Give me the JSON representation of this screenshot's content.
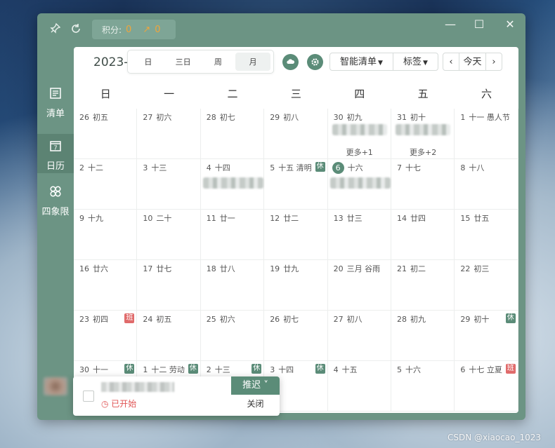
{
  "titlebar": {
    "points_label": "积分:",
    "points_value": "0",
    "trend_value": "0"
  },
  "window_controls": {
    "minimize": "—",
    "maximize": "☐",
    "close": "✕"
  },
  "sidebar": {
    "items": [
      {
        "label": "清单",
        "icon": "list-icon"
      },
      {
        "label": "日历",
        "icon": "calendar-icon",
        "day": "7"
      },
      {
        "label": "四象限",
        "icon": "quadrant-icon"
      }
    ]
  },
  "toolbar": {
    "year": "2023-(",
    "views": [
      "日",
      "三日",
      "周",
      "月"
    ],
    "active_view": "月",
    "smart_list": "智能清单",
    "tags": "标签",
    "prev": "‹",
    "today": "今天",
    "next": "›"
  },
  "weekdays": [
    "日",
    "一",
    "二",
    "三",
    "四",
    "五",
    "六"
  ],
  "weeks": [
    [
      {
        "d": "26",
        "l": "初五"
      },
      {
        "d": "27",
        "l": "初六"
      },
      {
        "d": "28",
        "l": "初七"
      },
      {
        "d": "29",
        "l": "初八"
      },
      {
        "d": "30",
        "l": "初九",
        "more": "更多+1"
      },
      {
        "d": "31",
        "l": "初十",
        "more": "更多+2"
      },
      {
        "d": "1",
        "l": "十一 愚人节"
      }
    ],
    [
      {
        "d": "2",
        "l": "十二"
      },
      {
        "d": "3",
        "l": "十三"
      },
      {
        "d": "4",
        "l": "十四"
      },
      {
        "d": "5",
        "l": "十五 清明",
        "badge": "休"
      },
      {
        "d": "6",
        "l": "十六",
        "today": true
      },
      {
        "d": "7",
        "l": "十七"
      },
      {
        "d": "8",
        "l": "十八"
      }
    ],
    [
      {
        "d": "9",
        "l": "十九"
      },
      {
        "d": "10",
        "l": "二十"
      },
      {
        "d": "11",
        "l": "廿一"
      },
      {
        "d": "12",
        "l": "廿二"
      },
      {
        "d": "13",
        "l": "廿三"
      },
      {
        "d": "14",
        "l": "廿四"
      },
      {
        "d": "15",
        "l": "廿五"
      }
    ],
    [
      {
        "d": "16",
        "l": "廿六"
      },
      {
        "d": "17",
        "l": "廿七"
      },
      {
        "d": "18",
        "l": "廿八"
      },
      {
        "d": "19",
        "l": "廿九"
      },
      {
        "d": "20",
        "l": "三月 谷雨"
      },
      {
        "d": "21",
        "l": "初二"
      },
      {
        "d": "22",
        "l": "初三"
      }
    ],
    [
      {
        "d": "23",
        "l": "初四",
        "badge": "班"
      },
      {
        "d": "24",
        "l": "初五"
      },
      {
        "d": "25",
        "l": "初六"
      },
      {
        "d": "26",
        "l": "初七"
      },
      {
        "d": "27",
        "l": "初八"
      },
      {
        "d": "28",
        "l": "初九"
      },
      {
        "d": "29",
        "l": "初十",
        "badge": "休"
      }
    ],
    [
      {
        "d": "30",
        "l": "十一",
        "badge": "休"
      },
      {
        "d": "1",
        "l": "十二 劳动",
        "badge": "休"
      },
      {
        "d": "2",
        "l": "十三",
        "badge": "休"
      },
      {
        "d": "3",
        "l": "十四",
        "badge": "休"
      },
      {
        "d": "4",
        "l": "十五"
      },
      {
        "d": "5",
        "l": "十六"
      },
      {
        "d": "6",
        "l": "十七 立夏",
        "badge": "班"
      }
    ]
  ],
  "popup": {
    "status": "已开始",
    "postpone": "推迟",
    "close": "关闭"
  },
  "watermark": "CSDN @xiaocao_1023",
  "colors": {
    "accent": "#5b8c78",
    "rest_badge": "#5b8c78",
    "work_badge": "#e06b6b",
    "window": "#6c9484"
  }
}
